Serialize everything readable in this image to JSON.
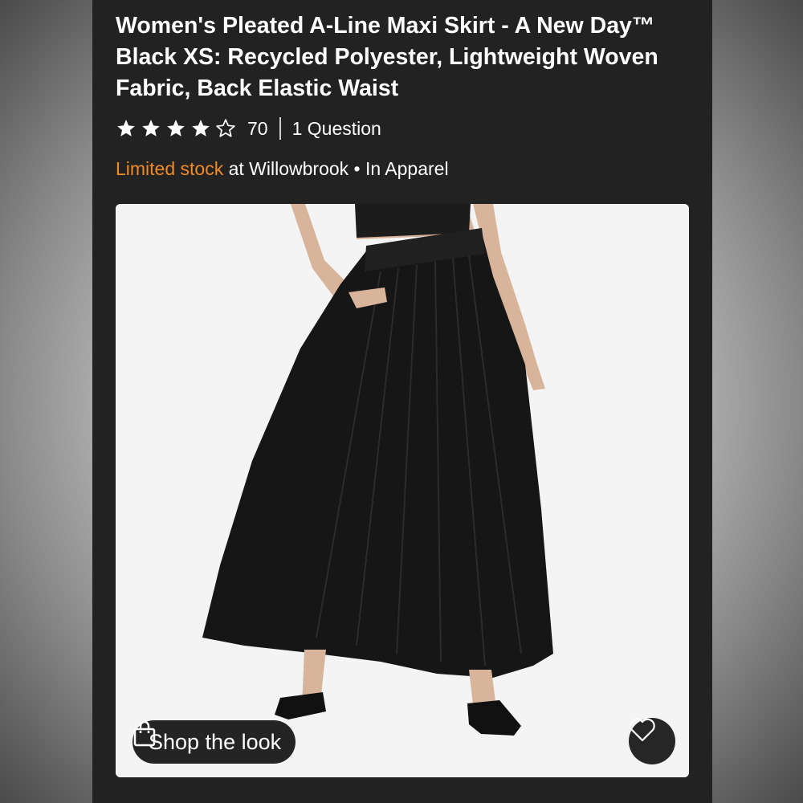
{
  "product": {
    "title": "Women's Pleated A-Line Maxi Skirt - A New Day™ Black XS: Recycled Polyester, Lightweight Woven Fabric, Back Elastic Waist",
    "rating": {
      "stars": 4,
      "max_stars": 5,
      "count": "70"
    },
    "questions_label": "1 Question",
    "stock": {
      "status": "Limited stock",
      "at_store": " at Willowbrook",
      "separator": " • ",
      "department": "In Apparel"
    }
  },
  "image": {
    "shop_the_look_label": "Shop the look",
    "shop_icon": "shopping-bag-icon",
    "favorite_icon": "heart-icon"
  },
  "colors": {
    "background": "#222222",
    "text": "#ffffff",
    "stock_accent": "#f08a24",
    "button_bg": "#242424"
  }
}
